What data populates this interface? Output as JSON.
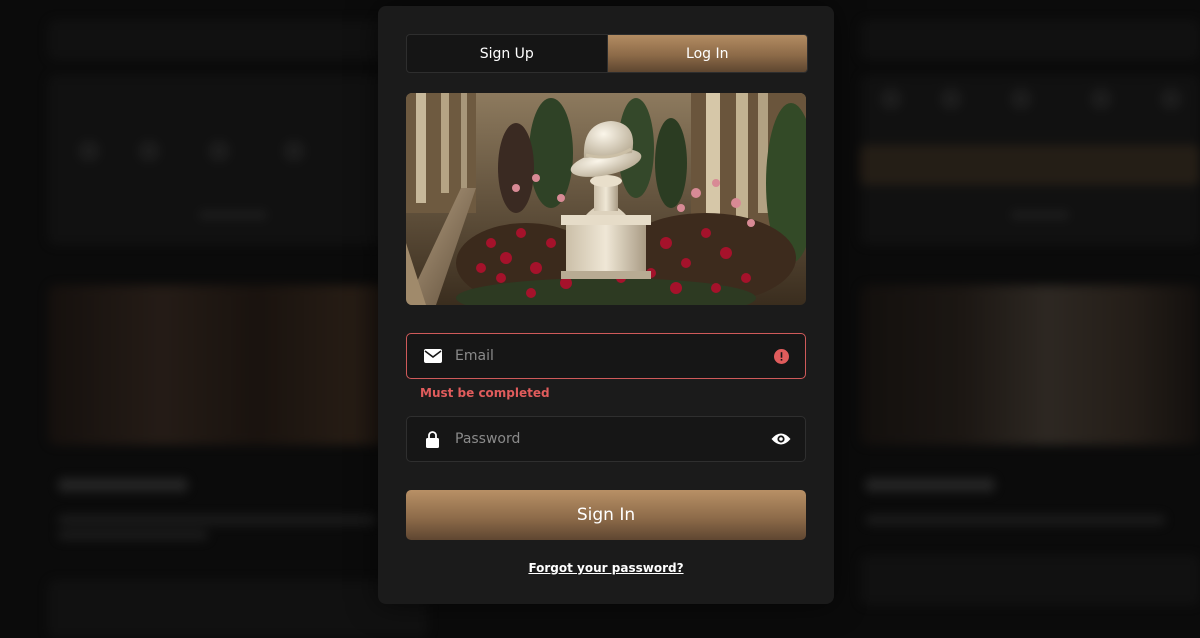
{
  "auth": {
    "tabs": [
      {
        "label": "Sign Up",
        "active": false
      },
      {
        "label": "Log In",
        "active": true
      }
    ],
    "email": {
      "placeholder": "Email",
      "icon": "envelope-icon",
      "status_icon": "error-icon"
    },
    "email_error": "Must be completed",
    "password": {
      "placeholder": "Password",
      "icon": "lock-icon",
      "toggle_icon": "eye-icon"
    },
    "submit_label": "Sign In",
    "forgot_label": "Forgot your password?"
  },
  "colors": {
    "accent_gold": "#a37e57",
    "error_red": "#e05c5c",
    "panel_bg": "#1b1b1b"
  }
}
